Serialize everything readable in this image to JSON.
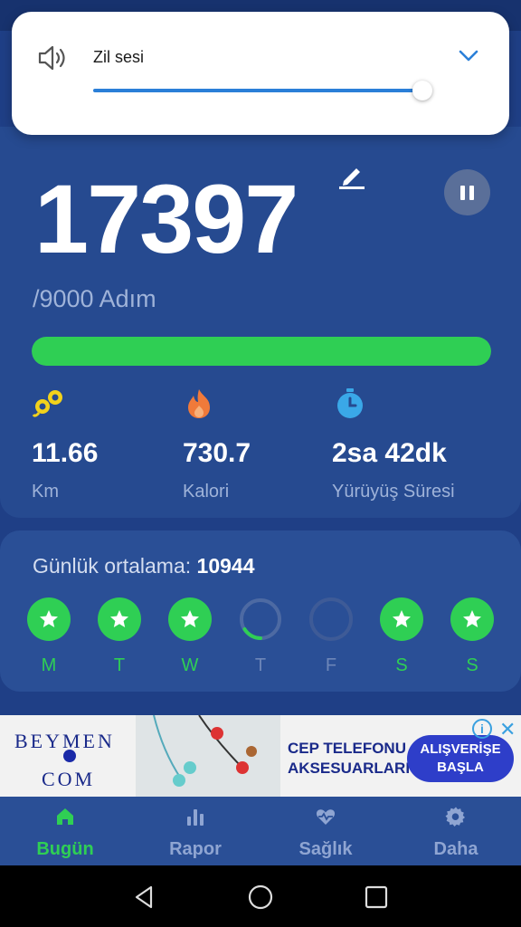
{
  "volume": {
    "label": "Zil sesi",
    "level_percent": 100
  },
  "steps": {
    "count": "17397",
    "goal_text": "/9000 Adım",
    "progress_percent": 100
  },
  "stats": [
    {
      "value": "11.66",
      "label": "Km",
      "icon": "footsteps-icon"
    },
    {
      "value": "730.7",
      "label": "Kalori",
      "icon": "flame-icon"
    },
    {
      "value": "2sa 42dk",
      "label": "Yürüyüş Süresi",
      "icon": "stopwatch-icon"
    }
  ],
  "weekly": {
    "avg_label": "Günlük ortalama:",
    "avg_value": "10944",
    "days": [
      {
        "label": "M",
        "status": "done"
      },
      {
        "label": "T",
        "status": "done"
      },
      {
        "label": "W",
        "status": "done"
      },
      {
        "label": "T",
        "status": "partial"
      },
      {
        "label": "F",
        "status": "empty"
      },
      {
        "label": "S",
        "status": "done"
      },
      {
        "label": "S",
        "status": "done"
      }
    ]
  },
  "ad": {
    "brand_line1": "BEYMEN",
    "brand_line2": "COM",
    "text_line1": "CEP TELEFONU",
    "text_line2": "AKSESUARLARI",
    "cta_line1": "ALIŞVERİŞE",
    "cta_line2": "BAŞLA"
  },
  "nav": [
    {
      "label": "Bugün",
      "icon": "home-icon",
      "active": true
    },
    {
      "label": "Rapor",
      "icon": "bar-chart-icon",
      "active": false
    },
    {
      "label": "Sağlık",
      "icon": "heart-pulse-icon",
      "active": false
    },
    {
      "label": "Daha",
      "icon": "gear-icon",
      "active": false
    }
  ],
  "colors": {
    "accent_green": "#2fcf54",
    "background_blue": "#1f3f86",
    "card_blue": "#264a90"
  }
}
